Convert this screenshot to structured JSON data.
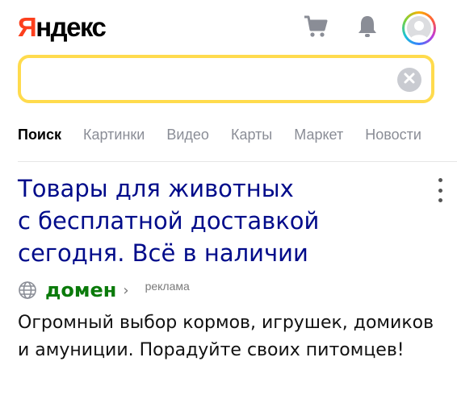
{
  "header": {
    "logo_first": "Я",
    "logo_rest": "ндекс",
    "icons": [
      "cart-icon",
      "bell-icon",
      "avatar"
    ]
  },
  "search": {
    "value": "",
    "placeholder": ""
  },
  "tabs": [
    {
      "label": "Поиск",
      "active": true
    },
    {
      "label": "Картинки",
      "active": false
    },
    {
      "label": "Видео",
      "active": false
    },
    {
      "label": "Карты",
      "active": false
    },
    {
      "label": "Маркет",
      "active": false
    },
    {
      "label": "Новости",
      "active": false
    }
  ],
  "result": {
    "title_lines": [
      "Товары для животных",
      "с бесплатной доставкой",
      "сегодня. Всё в наличии"
    ],
    "domain": "домен",
    "chevron": "›",
    "ad_label": "реклама",
    "snippet": "Огромный выбор кормов, игрушек, домиков и амуниции. Порадуйте своих питомцев!"
  },
  "colors": {
    "logo_accent": "#fc3f1d",
    "search_border": "#ffdb4d",
    "title": "#000b8a",
    "domain": "#0a7a0a",
    "tab_inactive": "#8a8d96"
  }
}
